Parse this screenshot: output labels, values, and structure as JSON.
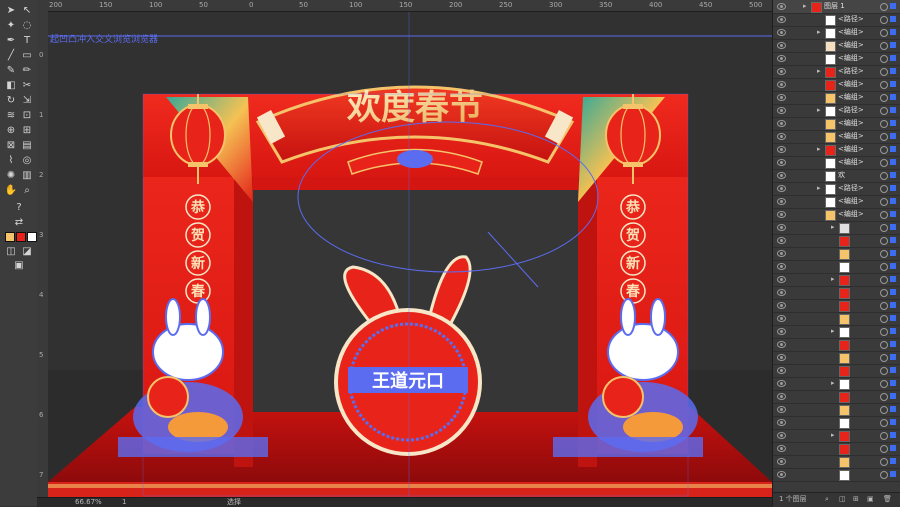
{
  "app": {
    "name": "Illustrator"
  },
  "ruler": {
    "top_ticks": [
      "200",
      "150",
      "100",
      "50",
      "0",
      "50",
      "100",
      "150",
      "200",
      "250",
      "300",
      "350",
      "400",
      "450",
      "500"
    ]
  },
  "ruler_left": {
    "ticks": [
      "0",
      "1",
      "2",
      "3",
      "4",
      "5",
      "6",
      "7"
    ]
  },
  "canvas": {
    "overlay_text": "起凹凸冲入交文浏览浏览器",
    "design": {
      "banner_title": "欢度春节",
      "couplet_left": [
        "恭",
        "贺",
        "新",
        "春"
      ],
      "couplet_right": [
        "恭",
        "贺",
        "新",
        "春"
      ],
      "center_badge_text": "王道元口",
      "colors": {
        "red": "#e8241a",
        "dark_red": "#b50f0e",
        "gold": "#f4c36a",
        "blue": "#5b6cf0",
        "cream": "#fbe1b5"
      }
    }
  },
  "status": {
    "zoom": "66.67%",
    "page": "1",
    "mode": "选择"
  },
  "layers_panel": {
    "top_layer": "图层 1",
    "items": [
      {
        "name": "<路径>",
        "thumb": "#ffffff"
      },
      {
        "name": "<编组>",
        "thumb": "#ffffff"
      },
      {
        "name": "<编组>",
        "thumb": "#f5e0c0"
      },
      {
        "name": "<编组>",
        "thumb": "#ffffff"
      },
      {
        "name": "<路径>",
        "thumb": "#e8241a"
      },
      {
        "name": "<编组>",
        "thumb": "#e8241a"
      },
      {
        "name": "<编组>",
        "thumb": "#f4c36a"
      },
      {
        "name": "<路径>",
        "thumb": "#ffffff"
      },
      {
        "name": "<编组>",
        "thumb": "#f4c36a"
      },
      {
        "name": "<编组>",
        "thumb": "#f4c36a"
      },
      {
        "name": "<编组>",
        "thumb": "#e8241a"
      },
      {
        "name": "<编组>",
        "thumb": "#ffffff"
      },
      {
        "name": "欢",
        "thumb": "#ffffff"
      },
      {
        "name": "<路径>",
        "thumb": "#ffffff"
      },
      {
        "name": "<编组>",
        "thumb": "#ffffff"
      },
      {
        "name": "<编组>",
        "thumb": "#f4c36a"
      }
    ],
    "sublayer_thumbs": [
      "#e0e0e0",
      "#e8241a",
      "#f4c36a",
      "#ffffff",
      "#e8241a",
      "#e8241a",
      "#e8241a",
      "#f4c36a",
      "#ffffff",
      "#e8241a",
      "#f4c36a",
      "#e8241a",
      "#ffffff",
      "#e8241a",
      "#f4c36a",
      "#ffffff",
      "#e8241a",
      "#e8241a",
      "#f4c36a",
      "#ffffff",
      "#e8241a",
      "#e8241a",
      "#ffffff"
    ],
    "footer_label": "1 个图层"
  }
}
